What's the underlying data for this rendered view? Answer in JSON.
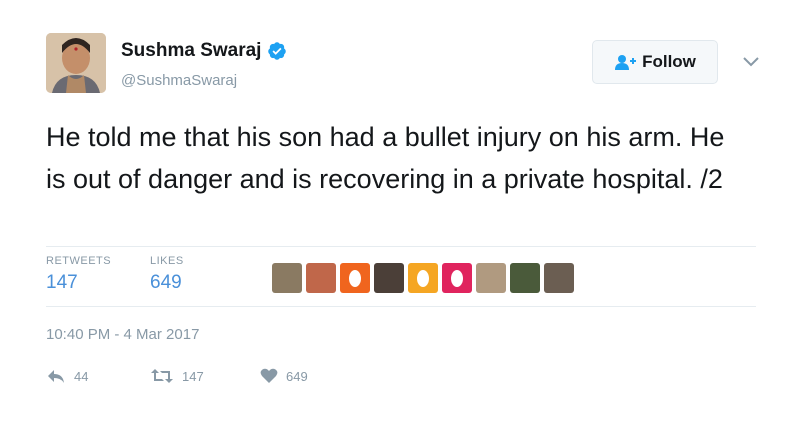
{
  "author": {
    "name": "Sushma Swaraj",
    "handle": "@SushmaSwaraj"
  },
  "follow_button": {
    "label": "Follow",
    "icon": "add-user-icon"
  },
  "tweet": {
    "text": "He told me that his son had a bullet injury on his arm. He is out of danger and is recovering in a private hospital. /2"
  },
  "stats": {
    "retweets_label": "RETWEETS",
    "retweets_value": "147",
    "likes_label": "LIKES",
    "likes_value": "649"
  },
  "likers": [
    {
      "kind": "photo",
      "color": "#8a7a62"
    },
    {
      "kind": "photo",
      "color": "#c0674a"
    },
    {
      "kind": "egg",
      "color": "#f0651e"
    },
    {
      "kind": "photo",
      "color": "#4b3f38"
    },
    {
      "kind": "egg",
      "color": "#f5a623"
    },
    {
      "kind": "egg",
      "color": "#e0245e"
    },
    {
      "kind": "photo",
      "color": "#b09a80"
    },
    {
      "kind": "photo",
      "color": "#4a5a3a"
    },
    {
      "kind": "photo",
      "color": "#6b5e52"
    }
  ],
  "timestamp": "10:40 PM - 4 Mar 2017",
  "actions": {
    "reply_count": "44",
    "retweet_count": "147",
    "like_count": "649"
  },
  "colors": {
    "verified": "#1da1f2",
    "link_blue": "#4a90d9",
    "muted": "#8899a6"
  }
}
